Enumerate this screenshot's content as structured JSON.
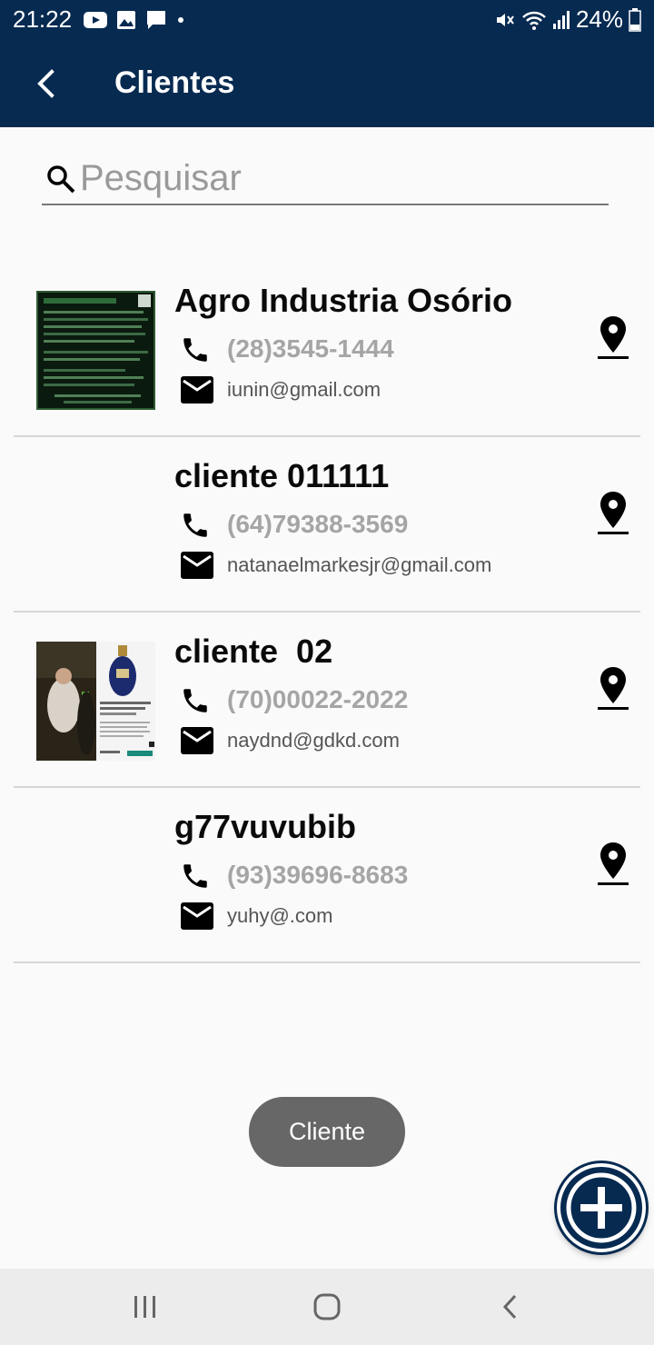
{
  "status_bar": {
    "time": "21:22",
    "battery": "24%",
    "left_icons": [
      "youtube-icon",
      "image-icon",
      "message-icon",
      "dot-icon"
    ],
    "right_icons": [
      "mute-icon",
      "wifi-icon",
      "signal-icon",
      "battery-icon"
    ]
  },
  "app_bar": {
    "title": "Clientes",
    "back_icon": "back-arrow-icon"
  },
  "search": {
    "placeholder": "Pesquisar",
    "value": ""
  },
  "clients": [
    {
      "name": "Agro Industria Osório",
      "phone": "(28)3545-1444",
      "email": "iunin@gmail.com",
      "has_photo": true
    },
    {
      "name": "cliente 011111",
      "phone": "(64)79388-3569",
      "email": "natanaelmarkesjr@gmail.com",
      "has_photo": false
    },
    {
      "name": "cliente  02",
      "phone": "(70)00022-2022",
      "email": "naydnd@gdkd.com",
      "has_photo": true
    },
    {
      "name": "g77vuvubib",
      "phone": "(93)39696-8683",
      "email": "yuhy@.com",
      "has_photo": false
    }
  ],
  "toast": {
    "text": "Cliente"
  },
  "fab": {
    "icon": "plus-icon"
  },
  "colors": {
    "primary": "#072a51",
    "phone_text": "#a5a5a5",
    "toast": "#676767"
  }
}
